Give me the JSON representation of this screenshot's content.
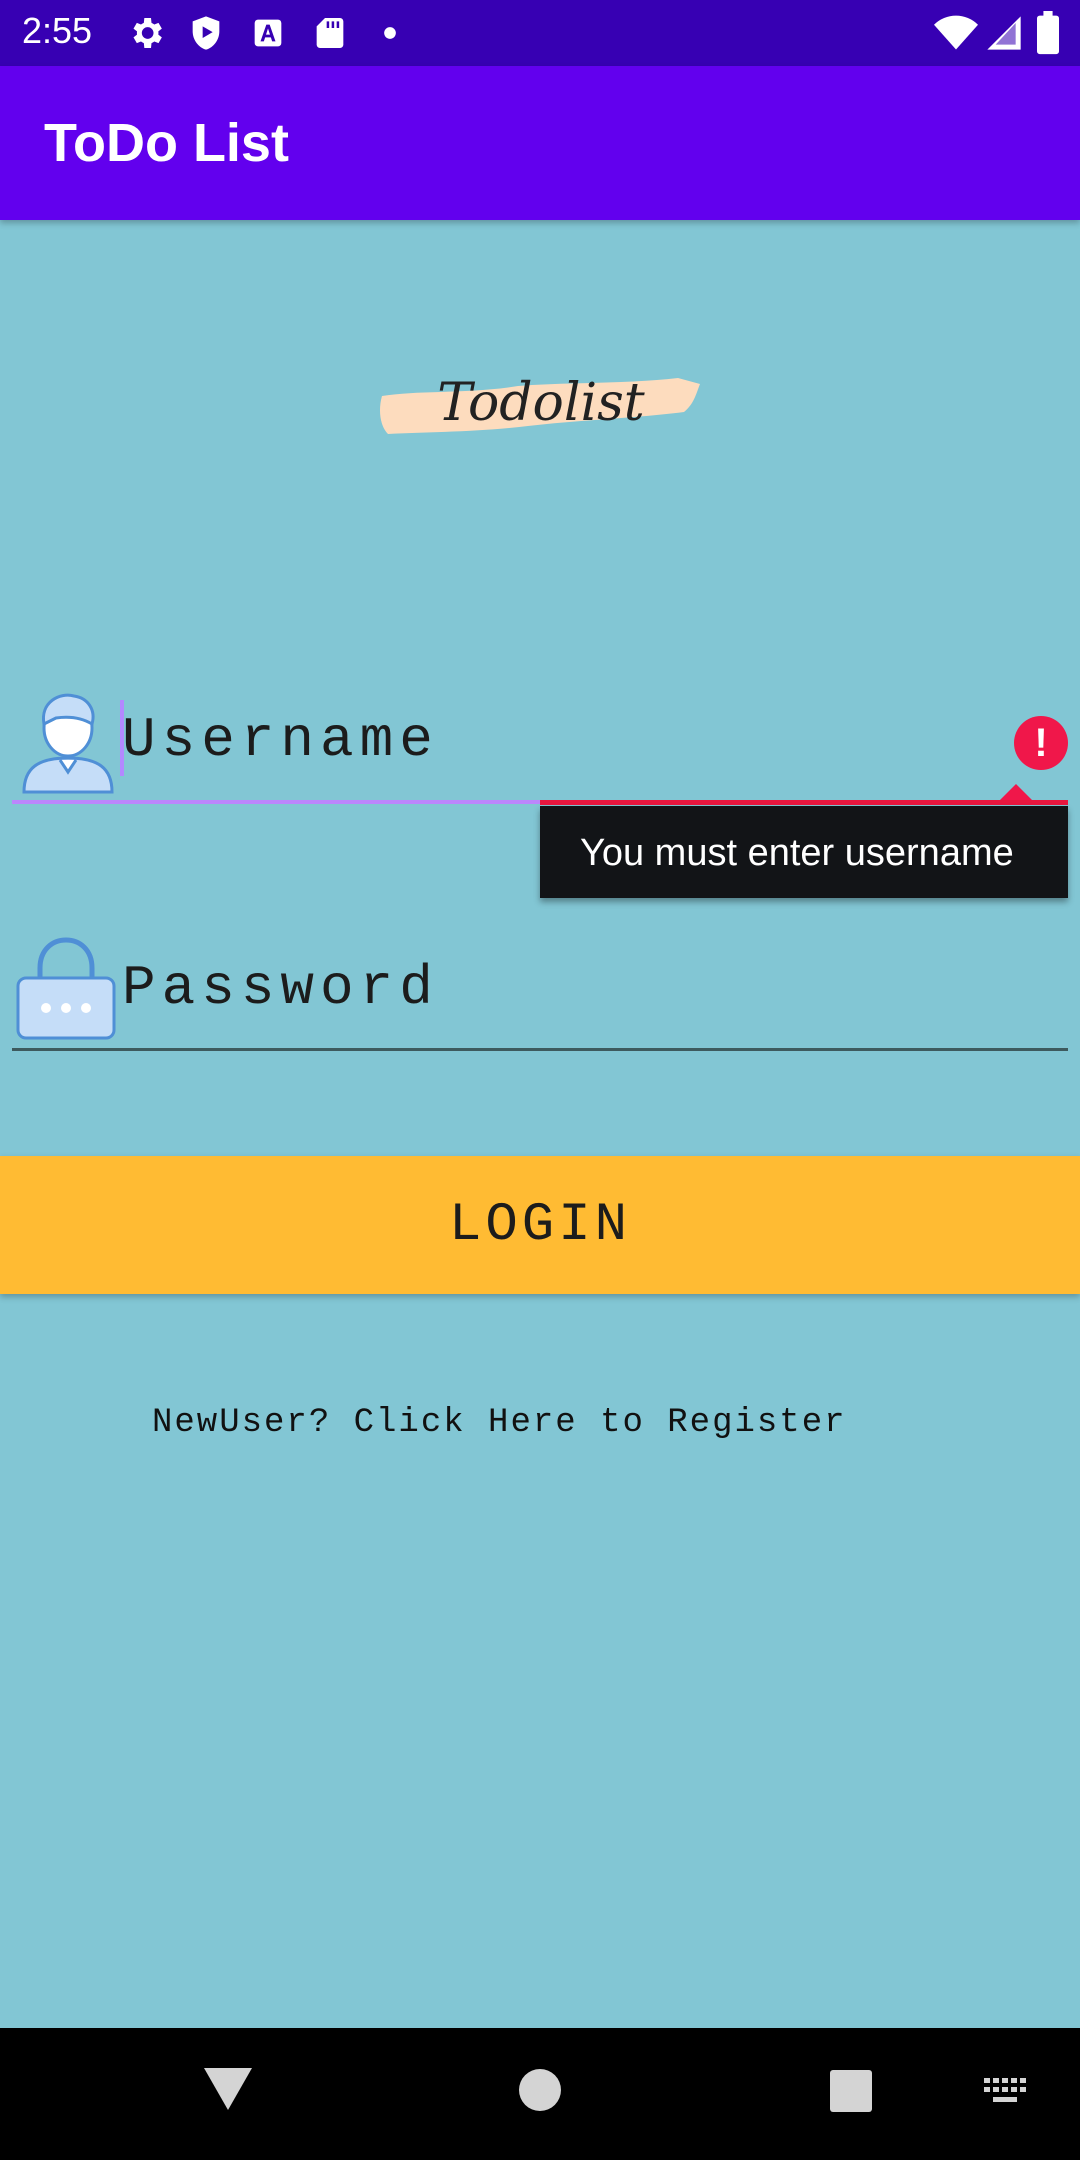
{
  "status_bar": {
    "time": "2:55",
    "left_icons": [
      "settings-icon",
      "shield-play-icon",
      "text-a-icon",
      "sd-card-icon",
      "dot-icon"
    ],
    "right_icons": [
      "wifi-icon",
      "signal-icon",
      "battery-icon"
    ]
  },
  "app_bar": {
    "title": "ToDo List"
  },
  "logo": {
    "text": "Todolist"
  },
  "username": {
    "placeholder": "Username",
    "error": "You must enter username"
  },
  "password": {
    "placeholder": "Password"
  },
  "login_button": {
    "label": "LOGIN"
  },
  "register_link": {
    "text": "NewUser? Click Here to Register"
  },
  "nav_bar": {
    "items": [
      "back-icon",
      "home-icon",
      "recents-icon",
      "keyboard-icon"
    ]
  },
  "colors": {
    "status_bar": "#3700b3",
    "app_bar": "#6200ee",
    "background": "#82c6d4",
    "login_button": "#ffbb33",
    "error": "#f0174a",
    "focus": "#bb86fc"
  }
}
